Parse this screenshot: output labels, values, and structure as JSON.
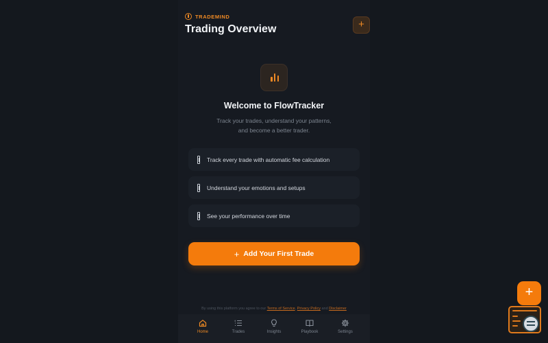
{
  "brand": {
    "name": "TRADEMIND",
    "icon": "tradebrand-icon"
  },
  "header": {
    "title": "Trading Overview",
    "add_icon": "+"
  },
  "welcome": {
    "icon": "bar-chart-icon",
    "title": "Welcome to FlowTracker",
    "subtitle_line1": "Track your trades, understand your patterns,",
    "subtitle_line2": "and become a better trader."
  },
  "features": [
    {
      "text": "Track every trade with automatic fee calculation"
    },
    {
      "text": "Understand your emotions and setups"
    },
    {
      "text": "See your performance over time"
    }
  ],
  "cta": {
    "plus": "+",
    "label": "Add Your First Trade"
  },
  "legal": {
    "prefix": "By using this platform you agree to our",
    "terms": "Terms of Service",
    "sep": ",",
    "privacy": "Privacy Policy",
    "and": "and",
    "disclaimer": "Disclaimer"
  },
  "tabs": [
    {
      "label": "Home",
      "icon": "home-icon",
      "active": true
    },
    {
      "label": "Trades",
      "icon": "list-icon",
      "active": false
    },
    {
      "label": "Insights",
      "icon": "lightbulb-icon",
      "active": false
    },
    {
      "label": "Playbook",
      "icon": "book-icon",
      "active": false
    },
    {
      "label": "Settings",
      "icon": "gear-icon",
      "active": false
    }
  ],
  "fab": {
    "label": "+"
  },
  "colors": {
    "accent": "#f47b0c",
    "background": "#14181e",
    "card": "#1b2028",
    "muted": "#7d8590"
  }
}
